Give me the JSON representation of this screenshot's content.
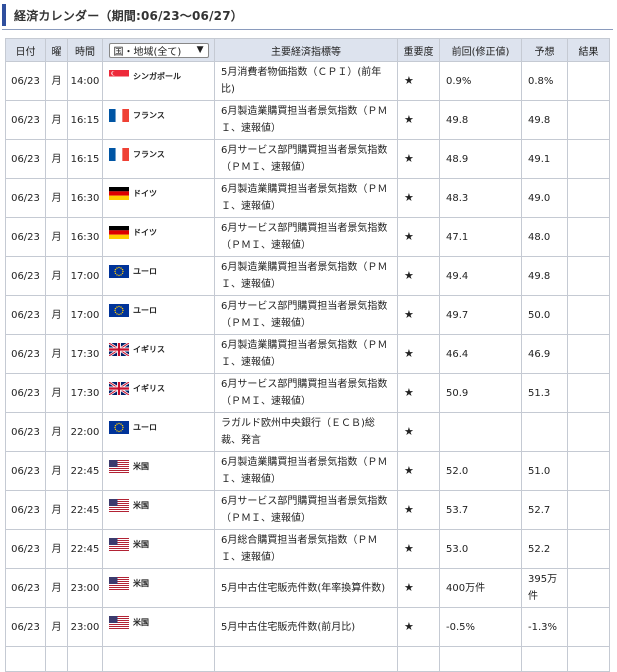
{
  "title": "経済カレンダー（期間:06/23〜06/27）",
  "headers": {
    "date": "日付",
    "dow": "曜",
    "time": "時間",
    "region": "国・地域(全て)",
    "indicator": "主要経済指標等",
    "importance": "重要度",
    "previous": "前回(修正値)",
    "forecast": "予想",
    "result": "結果"
  },
  "rows": [
    {
      "date": "06/23",
      "dow": "月",
      "time": "14:00",
      "flag": "sg",
      "country": "シンガポール",
      "indicator": "5月消費者物価指数（ＣＰＩ）(前年比)",
      "importance": "★",
      "previous": "0.9%",
      "forecast": "0.8%",
      "result": ""
    },
    {
      "date": "06/23",
      "dow": "月",
      "time": "16:15",
      "flag": "fr",
      "country": "フランス",
      "indicator": "6月製造業購買担当者景気指数（ＰＭＩ、速報値）",
      "importance": "★",
      "previous": "49.8",
      "forecast": "49.8",
      "result": ""
    },
    {
      "date": "06/23",
      "dow": "月",
      "time": "16:15",
      "flag": "fr",
      "country": "フランス",
      "indicator": "6月サービス部門購買担当者景気指数（ＰＭＩ、速報値）",
      "importance": "★",
      "previous": "48.9",
      "forecast": "49.1",
      "result": ""
    },
    {
      "date": "06/23",
      "dow": "月",
      "time": "16:30",
      "flag": "de",
      "country": "ドイツ",
      "indicator": "6月製造業購買担当者景気指数（ＰＭＩ、速報値）",
      "importance": "★",
      "previous": "48.3",
      "forecast": "49.0",
      "result": ""
    },
    {
      "date": "06/23",
      "dow": "月",
      "time": "16:30",
      "flag": "de",
      "country": "ドイツ",
      "indicator": "6月サービス部門購買担当者景気指数（ＰＭＩ、速報値）",
      "importance": "★",
      "previous": "47.1",
      "forecast": "48.0",
      "result": ""
    },
    {
      "date": "06/23",
      "dow": "月",
      "time": "17:00",
      "flag": "eu",
      "country": "ユーロ",
      "indicator": "6月製造業購買担当者景気指数（ＰＭＩ、速報値）",
      "importance": "★",
      "previous": "49.4",
      "forecast": "49.8",
      "result": ""
    },
    {
      "date": "06/23",
      "dow": "月",
      "time": "17:00",
      "flag": "eu",
      "country": "ユーロ",
      "indicator": "6月サービス部門購買担当者景気指数（ＰＭＩ、速報値）",
      "importance": "★",
      "previous": "49.7",
      "forecast": "50.0",
      "result": ""
    },
    {
      "date": "06/23",
      "dow": "月",
      "time": "17:30",
      "flag": "uk",
      "country": "イギリス",
      "indicator": "6月製造業購買担当者景気指数（ＰＭＩ、速報値）",
      "importance": "★",
      "previous": "46.4",
      "forecast": "46.9",
      "result": ""
    },
    {
      "date": "06/23",
      "dow": "月",
      "time": "17:30",
      "flag": "uk",
      "country": "イギリス",
      "indicator": "6月サービス部門購買担当者景気指数（ＰＭＩ、速報値）",
      "importance": "★",
      "previous": "50.9",
      "forecast": "51.3",
      "result": ""
    },
    {
      "date": "06/23",
      "dow": "月",
      "time": "22:00",
      "flag": "eu",
      "country": "ユーロ",
      "indicator": "ラガルド欧州中央銀行（ＥＣＢ)総裁、発言",
      "importance": "★",
      "previous": "",
      "forecast": "",
      "result": ""
    },
    {
      "date": "06/23",
      "dow": "月",
      "time": "22:45",
      "flag": "us",
      "country": "米国",
      "indicator": "6月製造業購買担当者景気指数（ＰＭＩ、速報値）",
      "importance": "★",
      "previous": "52.0",
      "forecast": "51.0",
      "result": ""
    },
    {
      "date": "06/23",
      "dow": "月",
      "time": "22:45",
      "flag": "us",
      "country": "米国",
      "indicator": "6月サービス部門購買担当者景気指数（ＰＭＩ、速報値）",
      "importance": "★",
      "previous": "53.7",
      "forecast": "52.7",
      "result": ""
    },
    {
      "date": "06/23",
      "dow": "月",
      "time": "22:45",
      "flag": "us",
      "country": "米国",
      "indicator": "6月総合購買担当者景気指数（ＰＭＩ、速報値）",
      "importance": "★",
      "previous": "53.0",
      "forecast": "52.2",
      "result": ""
    },
    {
      "date": "06/23",
      "dow": "月",
      "time": "23:00",
      "flag": "us",
      "country": "米国",
      "indicator": "5月中古住宅販売件数(年率換算件数)",
      "importance": "★",
      "previous": "400万件",
      "forecast": "395万件",
      "result": ""
    },
    {
      "date": "06/23",
      "dow": "月",
      "time": "23:00",
      "flag": "us",
      "country": "米国",
      "indicator": "5月中古住宅販売件数(前月比)",
      "importance": "★",
      "previous": "-0.5%",
      "forecast": "-1.3%",
      "result": ""
    }
  ]
}
